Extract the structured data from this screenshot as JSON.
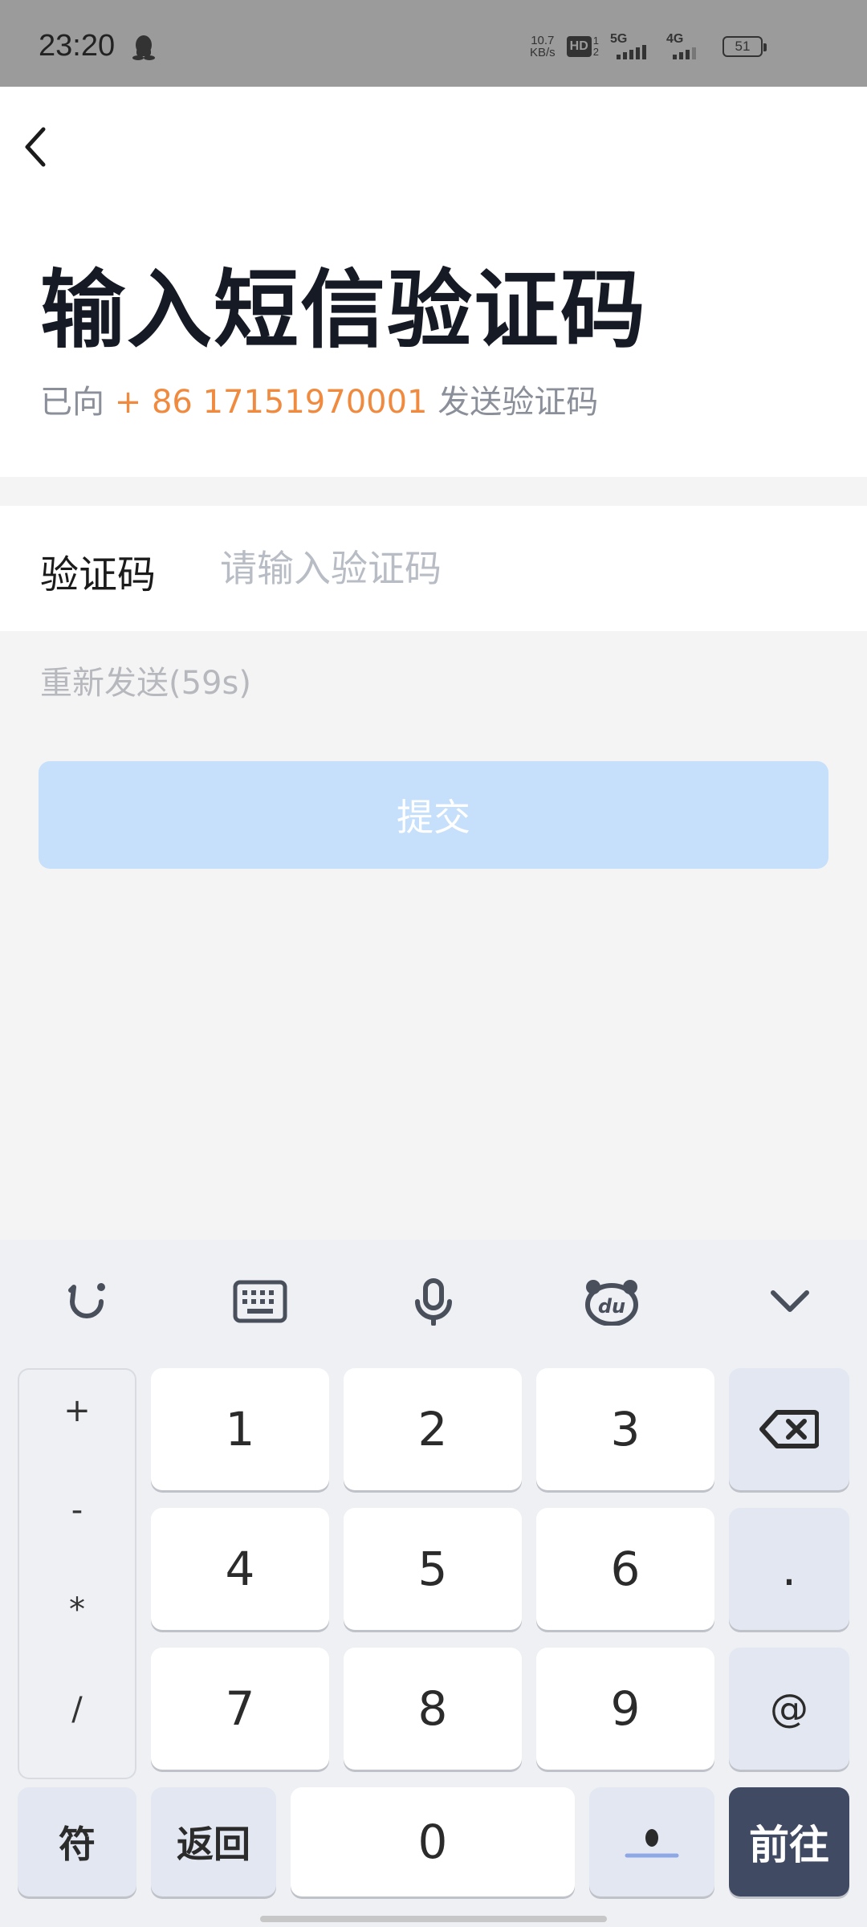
{
  "status_bar": {
    "time": "23:20",
    "net_speed_value": "10.7",
    "net_speed_unit": "KB/s",
    "hd_label": "HD",
    "hd_sims": [
      "1",
      "2"
    ],
    "signal_1": "5G",
    "signal_2": "4G",
    "battery": "51"
  },
  "header": {
    "title": "输入短信验证码",
    "subtitle_prefix": "已向",
    "phone": "+ 86 17151970001",
    "subtitle_suffix": "发送验证码"
  },
  "form": {
    "code_label": "验证码",
    "code_placeholder": "请输入验证码",
    "code_value": "",
    "resend": "重新发送(59s)",
    "submit": "提交"
  },
  "keyboard": {
    "toolbar": [
      "emoji-icon",
      "keyboard-icon",
      "microphone-icon",
      "du-bear-icon",
      "chevron-down-icon"
    ],
    "symbols": [
      "+",
      "-",
      "*",
      "/"
    ],
    "digits": [
      "1",
      "2",
      "3",
      "4",
      "5",
      "6",
      "7",
      "8",
      "9",
      "0"
    ],
    "dot": ".",
    "at": "@",
    "symbol_switch": "符",
    "back": "返回",
    "go": "前往"
  },
  "colors": {
    "phone_accent": "#f08a3f",
    "submit_disabled": "#c6e0fb",
    "go_key": "#414a63"
  }
}
